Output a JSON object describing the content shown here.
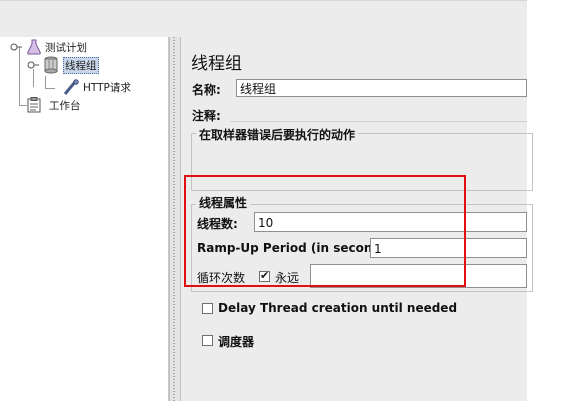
{
  "tree": {
    "items": [
      {
        "label": "测试计划",
        "icon": "test-plan-icon"
      },
      {
        "label": "线程组",
        "icon": "thread-group-icon",
        "selected": true
      },
      {
        "label": "HTTP请求",
        "icon": "http-sampler-icon"
      },
      {
        "label": "工作台",
        "icon": "workbench-icon"
      }
    ]
  },
  "panel": {
    "title": "线程组",
    "name_label": "名称:",
    "name_value": "线程组",
    "comment_label": "注释:",
    "comment_value": "",
    "error_action_title": "在取样器错误后要执行的动作",
    "thread_props_title": "线程属性",
    "threads_label": "线程数:",
    "threads_value": "10",
    "rampup_label": "Ramp-Up Period (in seconds):",
    "rampup_value": "1",
    "loop_label": "循环次数",
    "forever_label": "永远",
    "forever_checked": true,
    "loop_value": "",
    "delay_label": "Delay Thread creation until needed",
    "scheduler_label": "调度器"
  },
  "highlight_color": "#e01010"
}
